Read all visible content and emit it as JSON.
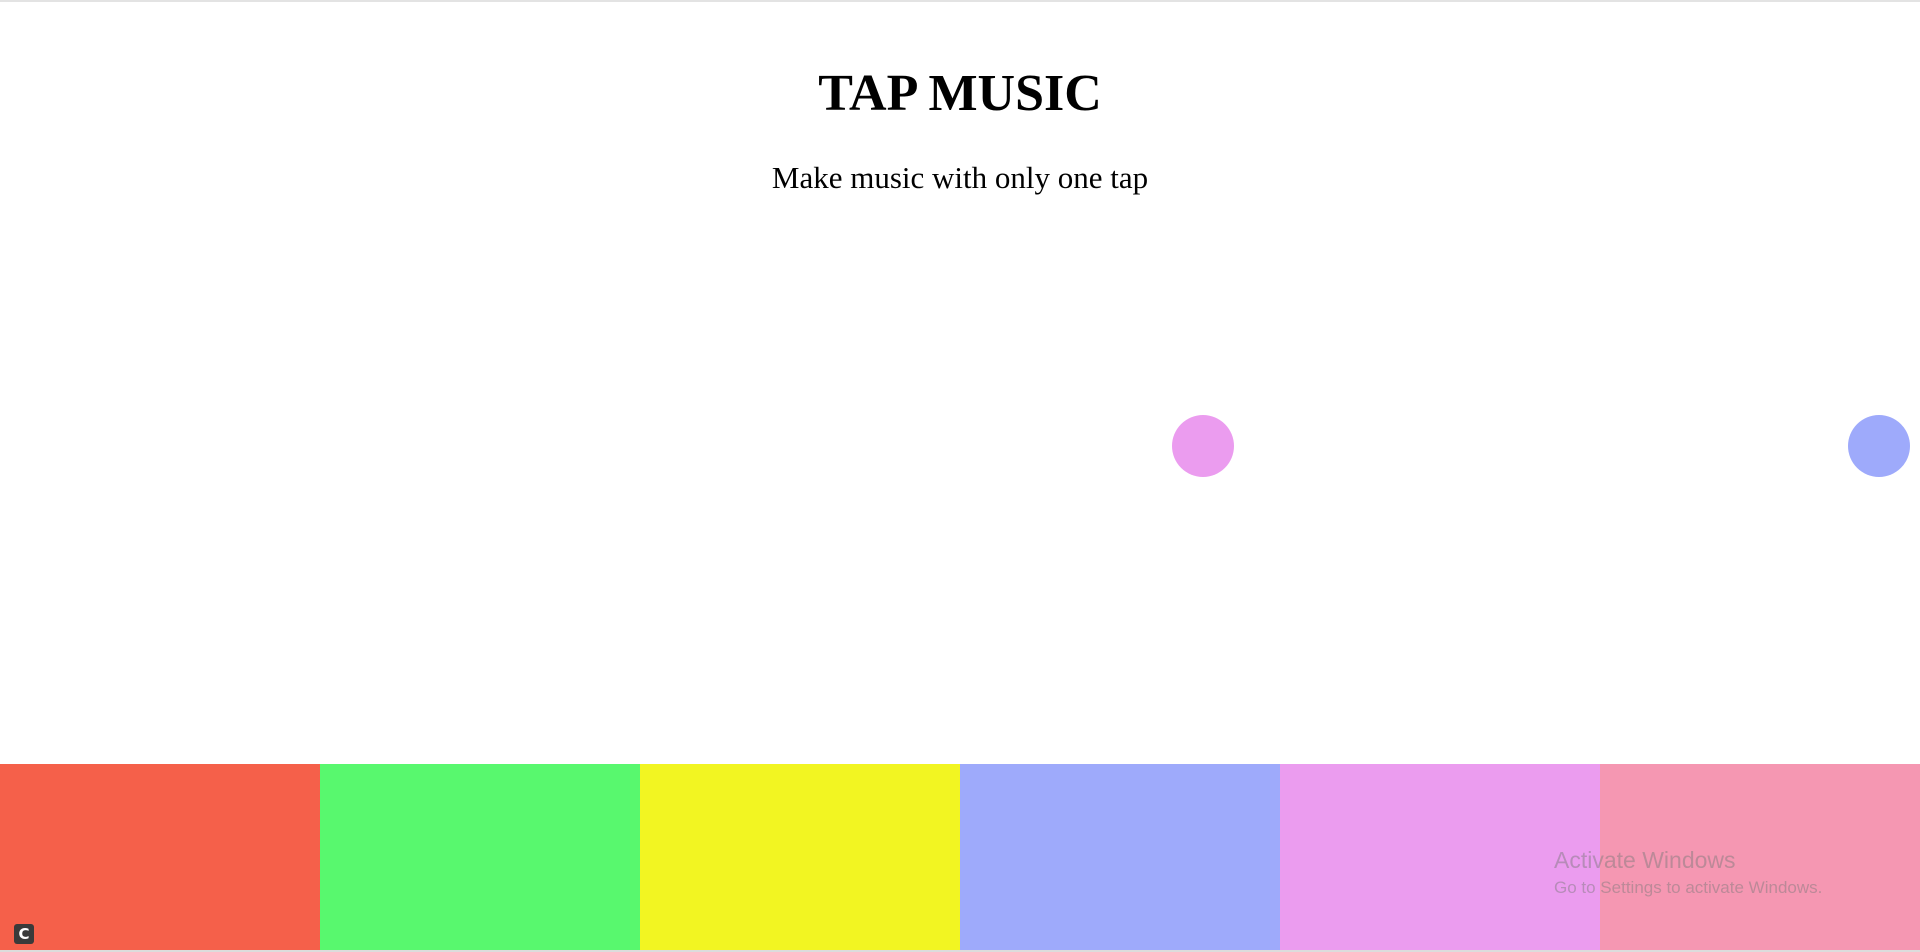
{
  "header": {
    "title": "TAP MUSIC",
    "subtitle": "Make music with only one tap"
  },
  "balls": [
    {
      "color": "#eb9cef"
    },
    {
      "color": "#9eaafb"
    }
  ],
  "pads": [
    {
      "color": "#f5604a"
    },
    {
      "color": "#58f86e"
    },
    {
      "color": "#f2f522"
    },
    {
      "color": "#9eaafb"
    },
    {
      "color": "#eb9cef"
    },
    {
      "color": "#f597b2"
    }
  ],
  "watermark": {
    "title": "Activate Windows",
    "subtitle": "Go to Settings to activate Windows."
  },
  "corner_icon": {
    "icon": "refresh-icon",
    "glyph": "C"
  }
}
